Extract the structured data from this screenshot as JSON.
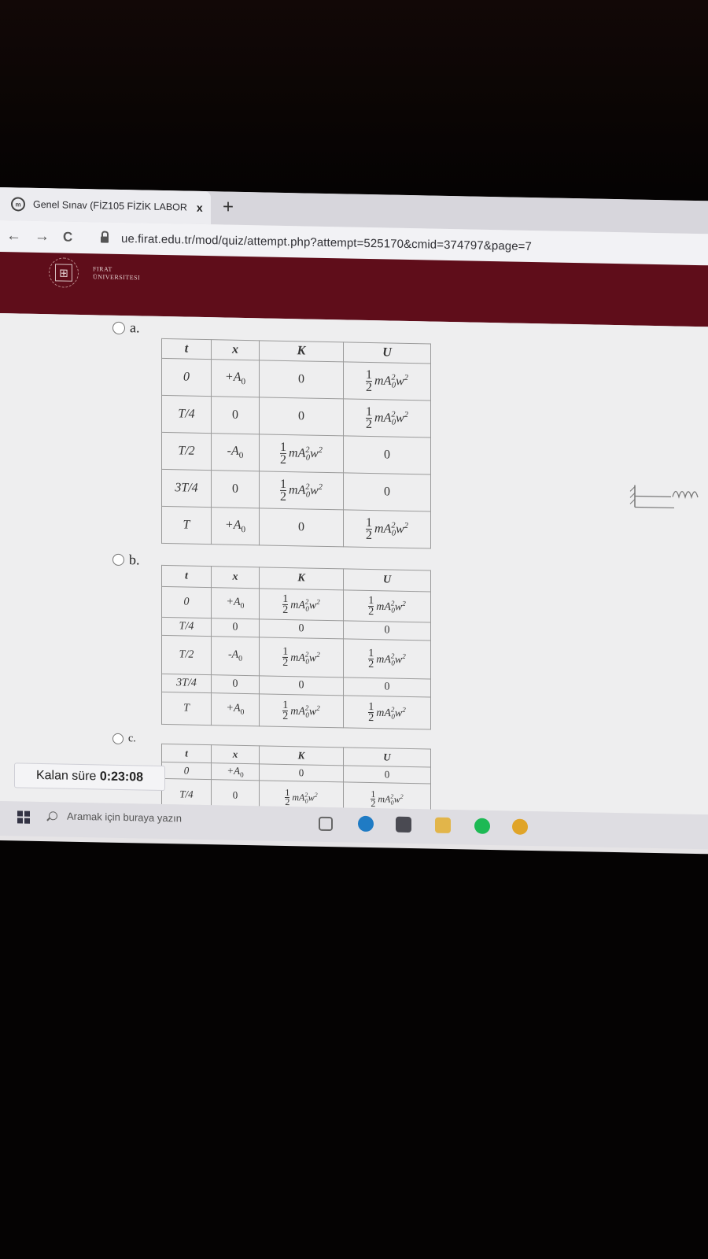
{
  "browser": {
    "tab_title": "Genel Sınav (FİZ105 FİZİK LABOR",
    "tab_close": "x",
    "new_tab": "+",
    "nav": {
      "back": "←",
      "forward": "→",
      "reload": "C"
    },
    "url": "ue.firat.edu.tr/mod/quiz/attempt.php?attempt=525170&cmid=374797&page=7"
  },
  "header": {
    "logo_line1": "FIRAT",
    "logo_line2": "ÜNIVERSITESI"
  },
  "quiz": {
    "headers": [
      "t",
      "x",
      "K",
      "U"
    ],
    "half": {
      "num": "1",
      "den": "2"
    },
    "energy_expr": "mA",
    "energy_sub": "0",
    "energy_sup": "2",
    "energy_w": "w",
    "energy_w_sup": "2",
    "options": [
      {
        "label": "a.",
        "rows": [
          {
            "t": "0",
            "x": "+A0",
            "K": "0",
            "U": "E"
          },
          {
            "t": "T/4",
            "x": "0",
            "K": "0",
            "U": "E"
          },
          {
            "t": "T/2",
            "x": "-A0",
            "K": "E",
            "U": "0"
          },
          {
            "t": "3T/4",
            "x": "0",
            "K": "E",
            "U": "0"
          },
          {
            "t": "T",
            "x": "+A0",
            "K": "0",
            "U": "E"
          }
        ]
      },
      {
        "label": "b.",
        "rows": [
          {
            "t": "0",
            "x": "+A0",
            "K": "E",
            "U": "E"
          },
          {
            "t": "T/4",
            "x": "0",
            "K": "0",
            "U": "0"
          },
          {
            "t": "T/2",
            "x": "-A0",
            "K": "E",
            "U": "E"
          },
          {
            "t": "3T/4",
            "x": "0",
            "K": "0",
            "U": "0"
          },
          {
            "t": "T",
            "x": "+A0",
            "K": "E",
            "U": "E"
          }
        ]
      },
      {
        "label": "c.",
        "rows": [
          {
            "t": "0",
            "x": "+A0",
            "K": "0",
            "U": "0"
          },
          {
            "t": "T/4",
            "x": "0",
            "K": "E",
            "U": "E"
          }
        ]
      }
    ]
  },
  "timer": {
    "label": "Kalan süre",
    "value": "0:23:08"
  },
  "taskbar": {
    "search_placeholder": "Aramak için buraya yazın"
  },
  "colors": {
    "header": "#5f0d1a",
    "page": "#eeeeef",
    "table_border": "#9a9a9a"
  }
}
